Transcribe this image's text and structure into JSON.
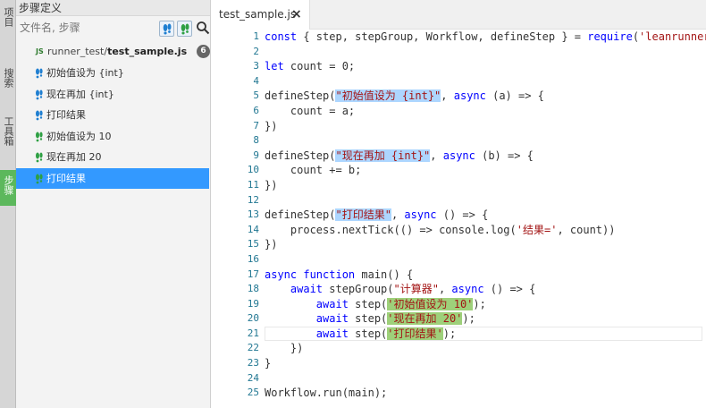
{
  "activity_bar": {
    "tabs": [
      {
        "label": "项目",
        "active": false
      },
      {
        "label": "搜索",
        "active": false
      },
      {
        "label": "工具箱",
        "active": false
      },
      {
        "label": "步骤",
        "active": true
      }
    ]
  },
  "panel": {
    "title": "步骤定义",
    "search": {
      "placeholder": "文件名, 步骤",
      "value": ""
    },
    "file": {
      "icon": "JS",
      "path": "runner_test/",
      "name": "test_sample.js",
      "count": "6"
    },
    "steps": [
      {
        "label": "初始值设为 {int}",
        "color": "#1f7fd1",
        "selected": false
      },
      {
        "label": "现在再加 {int}",
        "color": "#1f7fd1",
        "selected": false
      },
      {
        "label": "打印结果",
        "color": "#1f7fd1",
        "selected": false
      },
      {
        "label": "初始值设为 10",
        "color": "#2ea043",
        "selected": false
      },
      {
        "label": "现在再加 20",
        "color": "#2ea043",
        "selected": false
      },
      {
        "label": "打印结果",
        "color": "#2ea043",
        "selected": true
      }
    ],
    "colors": {
      "selection": "#3399ff",
      "definition_icon": "#1f7fd1",
      "usage_icon": "#2ea043"
    }
  },
  "editor": {
    "tab": {
      "label": "test_sample.js",
      "close": "×"
    },
    "lines": [
      {
        "n": "1"
      },
      {
        "n": "2"
      },
      {
        "n": "3"
      },
      {
        "n": "4"
      },
      {
        "n": "5"
      },
      {
        "n": "6"
      },
      {
        "n": "7"
      },
      {
        "n": "8"
      },
      {
        "n": "9"
      },
      {
        "n": "10"
      },
      {
        "n": "11"
      },
      {
        "n": "12"
      },
      {
        "n": "13"
      },
      {
        "n": "14"
      },
      {
        "n": "15"
      },
      {
        "n": "16"
      },
      {
        "n": "17"
      },
      {
        "n": "18"
      },
      {
        "n": "19"
      },
      {
        "n": "20"
      },
      {
        "n": "21"
      },
      {
        "n": "22"
      },
      {
        "n": "23"
      },
      {
        "n": "24"
      },
      {
        "n": "25"
      }
    ],
    "code": {
      "l1": [
        "const",
        " { step, stepGroup, Workflow, defineStep } = ",
        "require",
        "(",
        "'leanrunner'",
        ");"
      ],
      "l3": [
        "let",
        " count = 0;"
      ],
      "l5": [
        "defineStep(",
        "\"初始值设为 {int}\"",
        ", ",
        "async",
        " (a) => {"
      ],
      "l6": [
        "    count = a;"
      ],
      "l7": [
        "})"
      ],
      "l9": [
        "defineStep(",
        "\"现在再加 {int}\"",
        ", ",
        "async",
        " (b) => {"
      ],
      "l10": [
        "    count += b;"
      ],
      "l11": [
        "})"
      ],
      "l13": [
        "defineStep(",
        "\"打印结果\"",
        ", ",
        "async",
        " () => {"
      ],
      "l14": [
        "    process.nextTick(() => console.log(",
        "'结果='",
        ", count))"
      ],
      "l15": [
        "})"
      ],
      "l17": [
        "async",
        " ",
        "function",
        " main() {"
      ],
      "l18": [
        "    ",
        "await",
        " stepGroup(",
        "\"计算器\"",
        ", ",
        "async",
        " () => {"
      ],
      "l19": [
        "        ",
        "await",
        " step(",
        "'初始值设为 10'",
        ");"
      ],
      "l20": [
        "        ",
        "await",
        " step(",
        "'现在再加 20'",
        ");"
      ],
      "l21": [
        "        ",
        "await",
        " step(",
        "'打印结果'",
        ");"
      ],
      "l22": [
        "    })"
      ],
      "l23": [
        "}"
      ],
      "l25": [
        "Workflow.run(main);"
      ]
    },
    "colors": {
      "keyword": "#0000ff",
      "string": "#a31515",
      "line_number": "#237893",
      "def_highlight": "#add6ff",
      "step_highlight": "#9ed07a"
    }
  }
}
